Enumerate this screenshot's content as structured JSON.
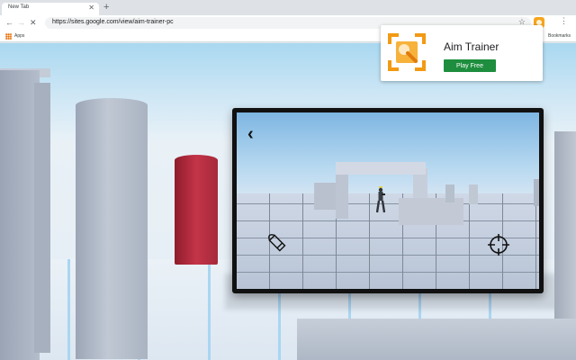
{
  "browser": {
    "tab_title": "New Tab",
    "tab_close": "✕",
    "new_tab": "+",
    "back": "←",
    "forward": "→",
    "reload": "✕",
    "url": "https://sites.google.com/view/aim-trainer-pc",
    "star": "☆",
    "menu": "⋮",
    "apps_label": "Apps",
    "bookmarks_right": "Bookmarks"
  },
  "promo": {
    "title": "Aim Trainer",
    "button_label": "Play Free",
    "button_color": "#1e8e3e",
    "icon": "aim-trainer-logo-icon"
  },
  "game_preview": {
    "back_icon": "‹",
    "left_control": "bullet-icon",
    "right_control": "crosshair-icon"
  },
  "colors": {
    "red_pillar": "#c43448",
    "sky": "#a9d8f0",
    "phone_frame": "#111111"
  }
}
